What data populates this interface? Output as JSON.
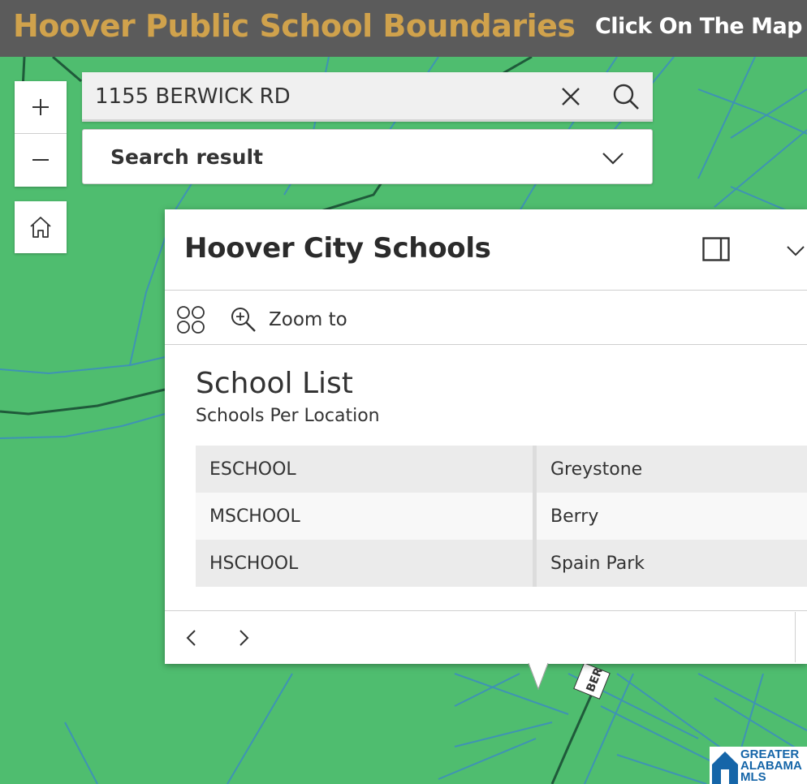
{
  "header": {
    "title": "Hoover Public School Boundaries",
    "hint": "Click On The Map"
  },
  "map_controls": {
    "zoom_in": "+",
    "zoom_out": "−"
  },
  "search": {
    "value": "1155 BERWICK RD",
    "result_label": "Search result"
  },
  "popup": {
    "title": "Hoover City Schools",
    "zoom_to_label": "Zoom to",
    "section_title": "School List",
    "section_subtitle": "Schools Per Location",
    "rows": [
      {
        "key": "ESCHOOL",
        "value": "Greystone"
      },
      {
        "key": "MSCHOOL",
        "value": "Berry"
      },
      {
        "key": "HSCHOOL",
        "value": "Spain Park"
      }
    ]
  },
  "map": {
    "street_label": "BER"
  },
  "logo": {
    "line1": "GREATER",
    "line2": "ALABAMA",
    "line3": "MLS"
  },
  "colors": {
    "map_green": "#4fbd6f",
    "header_bg": "#5b5b5b",
    "title_gold": "#d0a24c",
    "logo_blue": "#1565a8"
  }
}
